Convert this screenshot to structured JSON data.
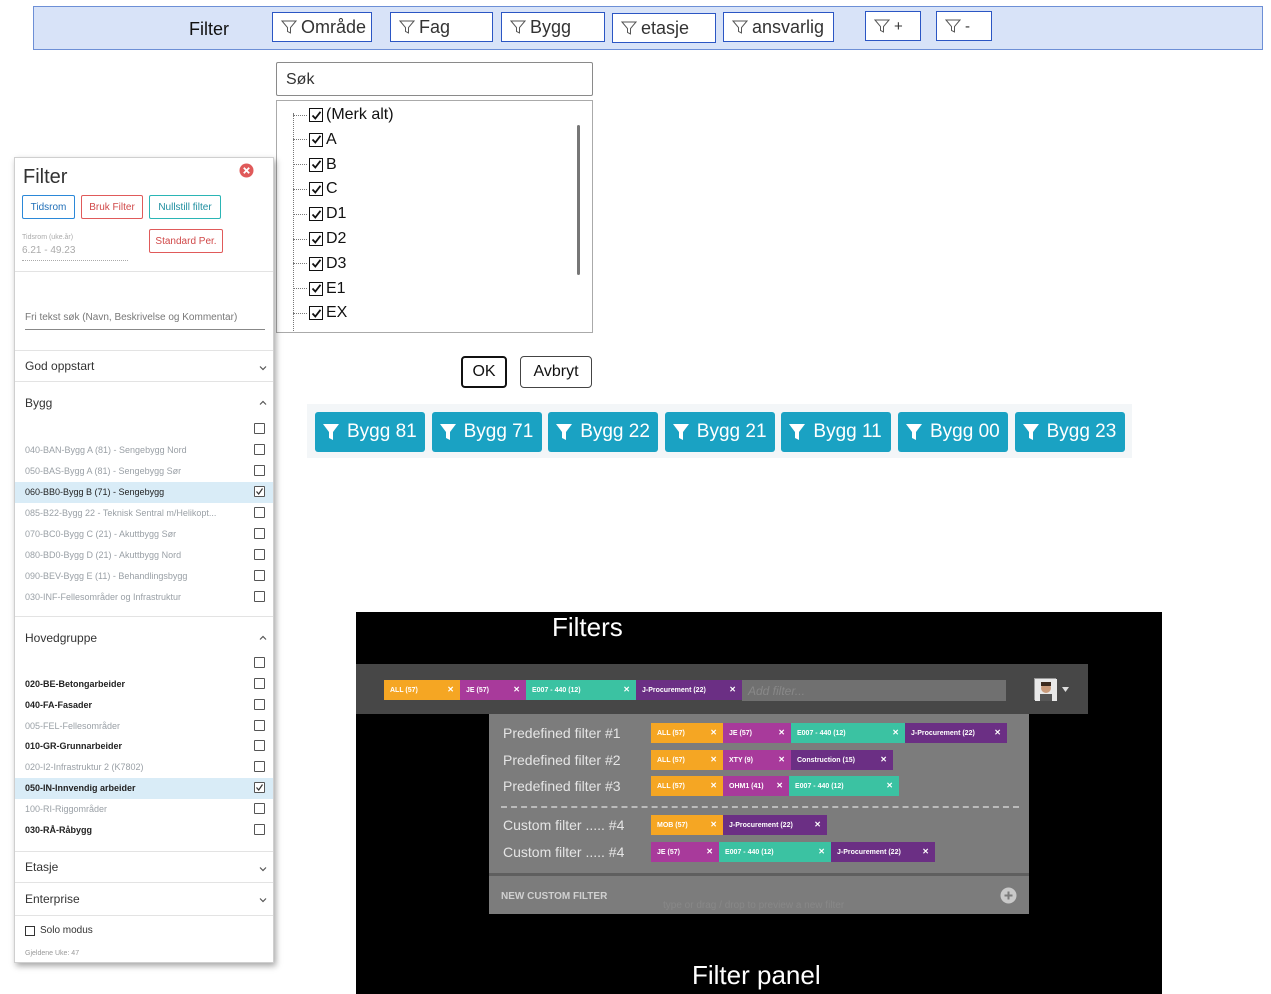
{
  "toolbar": {
    "label": "Filter",
    "buttons": [
      {
        "label": "Område"
      },
      {
        "label": "Fag"
      },
      {
        "label": "Bygg"
      },
      {
        "label": "etasje"
      },
      {
        "label": "ansvarlig"
      },
      {
        "label": "+"
      },
      {
        "label": "-"
      }
    ]
  },
  "dropdown": {
    "search_placeholder": "Søk",
    "items": [
      "(Merk alt)",
      "A",
      "B",
      "C",
      "D1",
      "D2",
      "D3",
      "E1",
      "EX"
    ],
    "ok_label": "OK",
    "cancel_label": "Avbryt"
  },
  "chips": [
    "Bygg 81",
    "Bygg 71",
    "Bygg 22",
    "Bygg 21",
    "Bygg 11",
    "Bygg 00",
    "Bygg 23"
  ],
  "panel": {
    "title": "Filter",
    "btn_tidsrom": "Tidsrom",
    "btn_bruk": "Bruk Filter",
    "btn_nullstill": "Nullstill filter",
    "btn_standard": "Standard Per.",
    "tidsrom_label": "Tidsrom (uke.år)",
    "tidsrom_value": "6.21 - 49.23",
    "fritekst_label": "Fri tekst søk (Navn, Beskrivelse og Kommentar)",
    "sections": {
      "god_oppstart": "God oppstart",
      "bygg": "Bygg",
      "hovedgruppe": "Hovedgruppe",
      "etasje": "Etasje",
      "enterprise": "Enterprise"
    },
    "bygg_items": [
      {
        "label": "040-BAN-Bygg A (81) - Sengebygg Nord",
        "checked": false
      },
      {
        "label": "050-BAS-Bygg A (81) - Sengebygg Sør",
        "checked": false
      },
      {
        "label": "060-BB0-Bygg B (71) - Sengebygg",
        "checked": true
      },
      {
        "label": "085-B22-Bygg 22 - Teknisk Sentral m/Helikopt...",
        "checked": false
      },
      {
        "label": "070-BC0-Bygg C (21) - Akuttbygg Sør",
        "checked": false
      },
      {
        "label": "080-BD0-Bygg D (21) - Akuttbygg Nord",
        "checked": false
      },
      {
        "label": "090-BEV-Bygg E (11) - Behandlingsbygg",
        "checked": false
      },
      {
        "label": "030-INF-Fellesområder og Infrastruktur",
        "checked": false
      }
    ],
    "hovedgruppe_items": [
      {
        "label": "020-BE-Betongarbeider",
        "checked": false,
        "bold": true
      },
      {
        "label": "040-FA-Fasader",
        "checked": false,
        "bold": true
      },
      {
        "label": "005-FEL-Fellesområder",
        "checked": false,
        "bold": false
      },
      {
        "label": "010-GR-Grunnarbeider",
        "checked": false,
        "bold": true
      },
      {
        "label": "020-I2-Infrastruktur 2 (K7802)",
        "checked": false,
        "bold": false
      },
      {
        "label": "050-IN-Innvendig arbeider",
        "checked": true,
        "bold": true
      },
      {
        "label": "100-RI-Riggområder",
        "checked": false,
        "bold": false
      },
      {
        "label": "030-RÅ-Råbygg",
        "checked": false,
        "bold": true
      }
    ],
    "solo_label": "Solo modus",
    "footer": "Gjeldene Uke: 47"
  },
  "dark": {
    "title_top": "Filters",
    "title_bottom": "Filter panel",
    "add_filter_placeholder": "Add filter...",
    "bar_tags": [
      {
        "label": "ALL (57)",
        "color": "#f5a623"
      },
      {
        "label": "JE (57)",
        "color": "#a83a9b"
      },
      {
        "label": "E007 - 440 (12)",
        "color": "#3bc2a2"
      },
      {
        "label": "J-Procurement (22)",
        "color": "#6b2f84"
      }
    ],
    "rows": [
      {
        "label": "Predefined filter #1",
        "tags": [
          {
            "label": "ALL (57)",
            "color": "#f5a623"
          },
          {
            "label": "JE (57)",
            "color": "#a83a9b"
          },
          {
            "label": "E007 - 440 (12)",
            "color": "#3bc2a2"
          },
          {
            "label": "J-Procurement (22)",
            "color": "#6b2f84"
          }
        ]
      },
      {
        "label": "Predefined filter #2",
        "tags": [
          {
            "label": "ALL (57)",
            "color": "#f5a623"
          },
          {
            "label": "XTY (9)",
            "color": "#a83a9b"
          },
          {
            "label": "Construction (15)",
            "color": "#6b2f84"
          }
        ]
      },
      {
        "label": "Predefined filter #3",
        "tags": [
          {
            "label": "ALL (57)",
            "color": "#f5a623"
          },
          {
            "label": "OHM1 (41)",
            "color": "#a83a9b"
          },
          {
            "label": "E007 - 440 (12)",
            "color": "#3bc2a2"
          }
        ]
      },
      {
        "label": "Custom filter ..... #4",
        "tags": [
          {
            "label": "MOB (57)",
            "color": "#f5a623"
          },
          {
            "label": "J-Procurement (22)",
            "color": "#6b2f84"
          }
        ]
      },
      {
        "label": "Custom filter ..... #4",
        "tags": [
          {
            "label": "JE (57)",
            "color": "#a83a9b"
          },
          {
            "label": "E007 - 440 (12)",
            "color": "#3bc2a2"
          },
          {
            "label": "J-Procurement (22)",
            "color": "#6b2f84"
          }
        ]
      }
    ],
    "new_custom_label": "NEW CUSTOM FILTER",
    "new_custom_hint": "type or drag / drop to preview a new filter"
  }
}
